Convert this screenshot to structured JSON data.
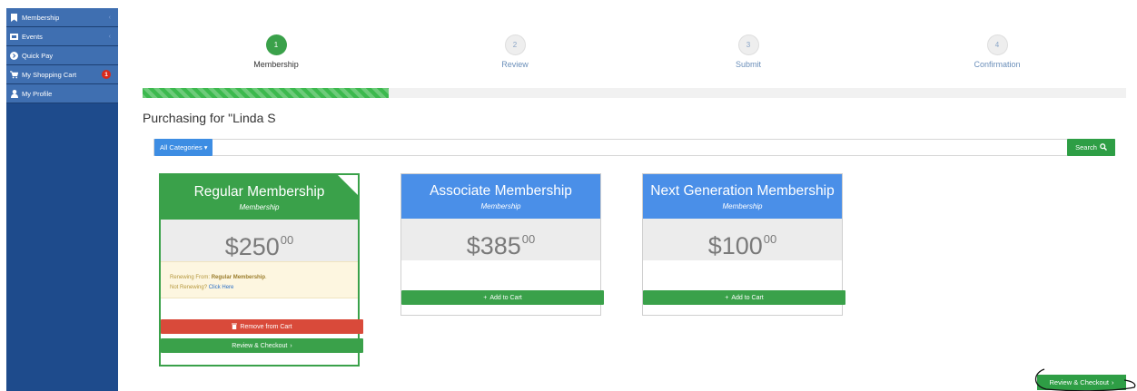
{
  "sidebar": {
    "items": [
      {
        "label": "Membership",
        "icon": "bookmark-icon",
        "has_chevron": true
      },
      {
        "label": "Events",
        "icon": "ticket-icon",
        "has_chevron": true
      },
      {
        "label": "Quick Pay",
        "icon": "arrow-circle-icon"
      },
      {
        "label": "My Shopping Cart",
        "icon": "cart-icon",
        "badge": "1"
      },
      {
        "label": "My Profile",
        "icon": "user-icon"
      }
    ],
    "colors": {
      "panel": "#1e4b8c",
      "item": "#3f6fb1",
      "badge": "#d9291c"
    }
  },
  "steps": [
    {
      "number": "1",
      "label": "Membership",
      "active": true
    },
    {
      "number": "2",
      "label": "Review",
      "active": false
    },
    {
      "number": "3",
      "label": "Submit",
      "active": false
    },
    {
      "number": "4",
      "label": "Confirmation",
      "active": false
    }
  ],
  "progress": {
    "fraction": 0.25,
    "color": "#3cb94e"
  },
  "purchasing_text": "Purchasing for \"Linda S",
  "search": {
    "category_label": "All Categories",
    "value": "",
    "placeholder": "",
    "button_label": "Search"
  },
  "cards": [
    {
      "name": "Regular Membership",
      "type": "Membership",
      "price_whole": "$250",
      "price_cents": "00",
      "header_color": "#3aa14a",
      "selected": true,
      "renew_prefix": "Renewing From: ",
      "renew_name": "Regular Membership",
      "renew_suffix": ".",
      "not_renewing": "Not Renewing? ",
      "click_here": "Click Here",
      "remove_label": "Remove from Cart",
      "checkout_label": "Review & Checkout"
    },
    {
      "name": "Associate Membership",
      "type": "Membership",
      "price_whole": "$385",
      "price_cents": "00",
      "header_color": "#4a8fe8",
      "selected": false,
      "add_label": "Add to Cart"
    },
    {
      "name": "Next Generation Membership",
      "type": "Membership",
      "price_whole": "$100",
      "price_cents": "00",
      "header_color": "#4a8fe8",
      "selected": false,
      "add_label": "Add to Cart"
    }
  ],
  "bottom_checkout_label": "Review & Checkout",
  "accent_green": "#3aa14a",
  "accent_blue": "#3d8de3"
}
